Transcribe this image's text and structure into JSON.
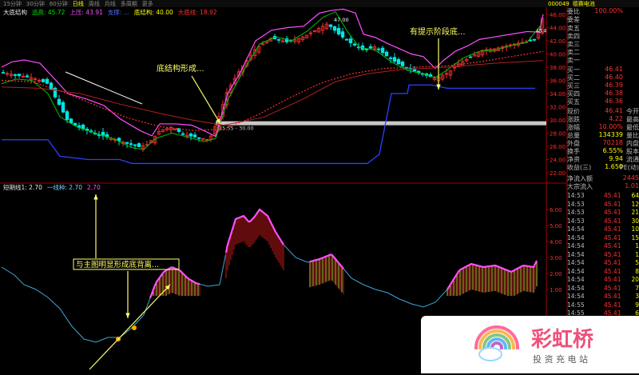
{
  "top_tabs": [
    "15分钟",
    "30分钟",
    "60分钟",
    "日线",
    "周线",
    "月线",
    "多周期",
    "更多"
  ],
  "top_active": 3,
  "header_right": {
    "code": "000049",
    "name": "德赛电池"
  },
  "main_legend": [
    {
      "text": "大底结构",
      "color": "#e8e8e8"
    },
    {
      "text": "追高: 45.72",
      "color": "#00e000"
    },
    {
      "text": "上压: 43.91",
      "color": "#ff4fff"
    },
    {
      "text": "支撑: ...",
      "color": "#4f6fff"
    },
    {
      "text": "底结构: 40.00",
      "color": "#ffff00"
    },
    {
      "text": "大底线: 18.92",
      "color": "#ff3030"
    }
  ],
  "sub_legend": [
    {
      "text": "短期线1: 2.70",
      "color": "#e8e8e8"
    },
    {
      "text": "一线种: 2.70",
      "color": "#6fd3ff"
    },
    {
      "text": "2.70",
      "color": "#ff4fff"
    }
  ],
  "price_axis": [
    "46.00",
    "44.00",
    "42.00",
    "40.00",
    "38.00",
    "36.00",
    "34.00",
    "32.00",
    "30.00",
    "28.00",
    "26.00",
    "24.00",
    "22.00"
  ],
  "sub_axis": [
    "6.00",
    "5.00",
    "4.00",
    "3.00",
    "2.00",
    "1.00"
  ],
  "annotations": {
    "bottom_structure": "底结构形成...",
    "stage_bottom": "有提示阶段底...",
    "divergence": "与主图明显形成底背离...",
    "peak_label": "47.00",
    "band_label": "25.55 - 30.00",
    "current_price_tag": "43.4"
  },
  "quote": {
    "wb_label": "委比",
    "wb": "100.00%",
    "wc_label": "委差",
    "wc": "",
    "asks": [
      {
        "l": "卖五",
        "p": ""
      },
      {
        "l": "卖四",
        "p": ""
      },
      {
        "l": "卖三",
        "p": ""
      },
      {
        "l": "卖二",
        "p": ""
      },
      {
        "l": "卖一",
        "p": ""
      }
    ],
    "bids": [
      {
        "l": "买一",
        "p": "46.41",
        "q": ""
      },
      {
        "l": "买二",
        "p": "46.40",
        "q": ""
      },
      {
        "l": "买三",
        "p": "46.39",
        "q": ""
      },
      {
        "l": "买四",
        "p": "46.38",
        "q": ""
      },
      {
        "l": "买五",
        "p": "46.36",
        "q": ""
      }
    ],
    "stats": [
      {
        "l": "现价",
        "v": "46.41",
        "c": "red",
        "l2": "今开",
        "v2": ""
      },
      {
        "l": "涨跌",
        "v": "4.22",
        "c": "red",
        "l2": "最高",
        "v2": ""
      },
      {
        "l": "涨幅",
        "v": "10.00%",
        "c": "red",
        "l2": "最低",
        "v2": ""
      },
      {
        "l": "总量",
        "v": "134339",
        "c": "yellow",
        "l2": "量比",
        "v2": ""
      },
      {
        "l": "外盘",
        "v": "70218",
        "c": "red",
        "l2": "内盘",
        "v2": ""
      },
      {
        "l": "换手",
        "v": "6.55%",
        "c": "yellow",
        "l2": "股本",
        "v2": ""
      },
      {
        "l": "净资",
        "v": "9.94",
        "c": "yellow",
        "l2": "流通",
        "v2": ""
      },
      {
        "l": "收益(三)",
        "v": "1.650",
        "c": "yellow",
        "l2": "PE(动)",
        "v2": ""
      }
    ],
    "netflow_label": "净流入额",
    "netflow": "2445",
    "bigflow_label": "大宗流入",
    "bigflow": "1.01"
  },
  "ticks": [
    {
      "t": "14:53",
      "p": "45.41",
      "q": "64"
    },
    {
      "t": "14:53",
      "p": "45.41",
      "q": "12"
    },
    {
      "t": "14:53",
      "p": "45.41",
      "q": "21"
    },
    {
      "t": "14:53",
      "p": "45.41",
      "q": "30"
    },
    {
      "t": "14:54",
      "p": "45.41",
      "q": "10"
    },
    {
      "t": "14:54",
      "p": "45.41",
      "q": "15"
    },
    {
      "t": "14:54",
      "p": "45.41",
      "q": "1"
    },
    {
      "t": "14:54",
      "p": "45.41",
      "q": "1"
    },
    {
      "t": "14:54",
      "p": "45.41",
      "q": "5"
    },
    {
      "t": "14:54",
      "p": "45.41",
      "q": "8"
    },
    {
      "t": "14:54",
      "p": "45.41",
      "q": "20"
    },
    {
      "t": "14:54",
      "p": "45.41",
      "q": "7"
    },
    {
      "t": "14:54",
      "p": "45.41",
      "q": "3"
    },
    {
      "t": "14:55",
      "p": "45.41",
      "q": "9"
    },
    {
      "t": "14:55",
      "p": "45.41",
      "q": "6"
    },
    {
      "t": "14:55",
      "p": "45.41",
      "q": "2"
    },
    {
      "t": "14:55",
      "p": "45.41",
      "q": "8"
    },
    {
      "t": "14:55",
      "p": "45.41",
      "q": "1"
    },
    {
      "t": "14:55",
      "p": "45.41",
      "q": "4"
    },
    {
      "t": "14:55",
      "p": "45.41",
      "q": "6"
    }
  ],
  "watermark": {
    "title": "彩虹桥",
    "subtitle": "投 资 充 电 站"
  },
  "colors": {
    "up": "#ff3030",
    "down": "#00e5e5",
    "ma_green": "#00c000",
    "ma_magenta": "#ff4fff",
    "support": "#2f3fff",
    "ma_red": "#ff3030",
    "annot": "#ffff66"
  }
}
